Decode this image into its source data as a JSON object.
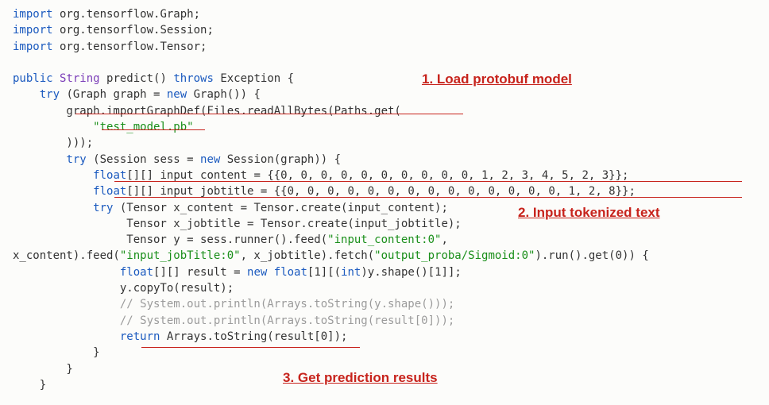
{
  "code": [
    {
      "t": "line",
      "parts": [
        {
          "c": "kw",
          "s": "import"
        },
        {
          "c": "plain",
          "s": " org.tensorflow.Graph;"
        }
      ]
    },
    {
      "t": "line",
      "parts": [
        {
          "c": "kw",
          "s": "import"
        },
        {
          "c": "plain",
          "s": " org.tensorflow.Session;"
        }
      ]
    },
    {
      "t": "line",
      "parts": [
        {
          "c": "kw",
          "s": "import"
        },
        {
          "c": "plain",
          "s": " org.tensorflow.Tensor;"
        }
      ]
    },
    {
      "t": "blank"
    },
    {
      "t": "line",
      "parts": [
        {
          "c": "kw",
          "s": "public"
        },
        {
          "c": "plain",
          "s": " "
        },
        {
          "c": "type",
          "s": "String"
        },
        {
          "c": "plain",
          "s": " predict() "
        },
        {
          "c": "kw",
          "s": "throws"
        },
        {
          "c": "plain",
          "s": " Exception {"
        }
      ]
    },
    {
      "t": "line",
      "parts": [
        {
          "c": "plain",
          "s": "    "
        },
        {
          "c": "kw",
          "s": "try"
        },
        {
          "c": "plain",
          "s": " (Graph graph = "
        },
        {
          "c": "kw",
          "s": "new"
        },
        {
          "c": "plain",
          "s": " Graph()) {"
        }
      ]
    },
    {
      "t": "line",
      "parts": [
        {
          "c": "plain",
          "s": "        graph.importGraphDef(Files.readAllBytes(Paths.get("
        }
      ]
    },
    {
      "t": "line",
      "parts": [
        {
          "c": "plain",
          "s": "            "
        },
        {
          "c": "str",
          "s": "\"test_model.pb\""
        }
      ]
    },
    {
      "t": "line",
      "parts": [
        {
          "c": "plain",
          "s": "        )));"
        }
      ]
    },
    {
      "t": "line",
      "parts": [
        {
          "c": "plain",
          "s": "        "
        },
        {
          "c": "kw",
          "s": "try"
        },
        {
          "c": "plain",
          "s": " (Session sess = "
        },
        {
          "c": "kw",
          "s": "new"
        },
        {
          "c": "plain",
          "s": " Session(graph)) {"
        }
      ]
    },
    {
      "t": "line",
      "parts": [
        {
          "c": "plain",
          "s": "            "
        },
        {
          "c": "kw",
          "s": "float"
        },
        {
          "c": "plain",
          "s": "[][] input_content = {{0, 0, 0, 0, 0, 0, 0, 0, 0, 0, 1, 2, 3, 4, 5, 2, 3}};"
        }
      ]
    },
    {
      "t": "line",
      "parts": [
        {
          "c": "plain",
          "s": "            "
        },
        {
          "c": "kw",
          "s": "float"
        },
        {
          "c": "plain",
          "s": "[][] input_jobtitle = {{0, 0, 0, 0, 0, 0, 0, 0, 0, 0, 0, 0, 0, 0, 1, 2, 8}};"
        }
      ]
    },
    {
      "t": "line",
      "parts": [
        {
          "c": "plain",
          "s": "            "
        },
        {
          "c": "kw",
          "s": "try"
        },
        {
          "c": "plain",
          "s": " (Tensor x_content = Tensor.create(input_content);"
        }
      ]
    },
    {
      "t": "line",
      "parts": [
        {
          "c": "plain",
          "s": "                 Tensor x_jobtitle = Tensor.create(input_jobtitle);"
        }
      ]
    },
    {
      "t": "line",
      "parts": [
        {
          "c": "plain",
          "s": "                 Tensor y = sess.runner().feed("
        },
        {
          "c": "str",
          "s": "\"input_content:0\""
        },
        {
          "c": "plain",
          "s": ","
        }
      ]
    },
    {
      "t": "line",
      "parts": [
        {
          "c": "plain",
          "s": "x_content).feed("
        },
        {
          "c": "str",
          "s": "\"input_jobTitle:0\""
        },
        {
          "c": "plain",
          "s": ", x_jobtitle).fetch("
        },
        {
          "c": "str",
          "s": "\"output_proba/Sigmoid:0\""
        },
        {
          "c": "plain",
          "s": ").run().get(0)) {"
        }
      ]
    },
    {
      "t": "line",
      "parts": [
        {
          "c": "plain",
          "s": "                "
        },
        {
          "c": "kw",
          "s": "float"
        },
        {
          "c": "plain",
          "s": "[][] result = "
        },
        {
          "c": "kw",
          "s": "new"
        },
        {
          "c": "plain",
          "s": " "
        },
        {
          "c": "kw",
          "s": "float"
        },
        {
          "c": "plain",
          "s": "[1][("
        },
        {
          "c": "kw",
          "s": "int"
        },
        {
          "c": "plain",
          "s": ")y.shape()[1]];"
        }
      ]
    },
    {
      "t": "line",
      "parts": [
        {
          "c": "plain",
          "s": "                y.copyTo(result);"
        }
      ]
    },
    {
      "t": "line",
      "parts": [
        {
          "c": "plain",
          "s": "                "
        },
        {
          "c": "cmt",
          "s": "// System.out.println(Arrays.toString(y.shape()));"
        }
      ]
    },
    {
      "t": "line",
      "parts": [
        {
          "c": "plain",
          "s": "                "
        },
        {
          "c": "cmt",
          "s": "// System.out.println(Arrays.toString(result[0]));"
        }
      ]
    },
    {
      "t": "line",
      "parts": [
        {
          "c": "plain",
          "s": "                "
        },
        {
          "c": "kw",
          "s": "return"
        },
        {
          "c": "plain",
          "s": " Arrays.toString(result[0]);"
        }
      ]
    },
    {
      "t": "line",
      "parts": [
        {
          "c": "plain",
          "s": "            }"
        }
      ]
    },
    {
      "t": "line",
      "parts": [
        {
          "c": "plain",
          "s": "        }"
        }
      ]
    },
    {
      "t": "line",
      "parts": [
        {
          "c": "plain",
          "s": "    }"
        }
      ]
    }
  ],
  "annotations": {
    "a1": "1. Load protobuf model",
    "a2": "2. Input tokenized text",
    "a3": "3. Get prediction results"
  }
}
